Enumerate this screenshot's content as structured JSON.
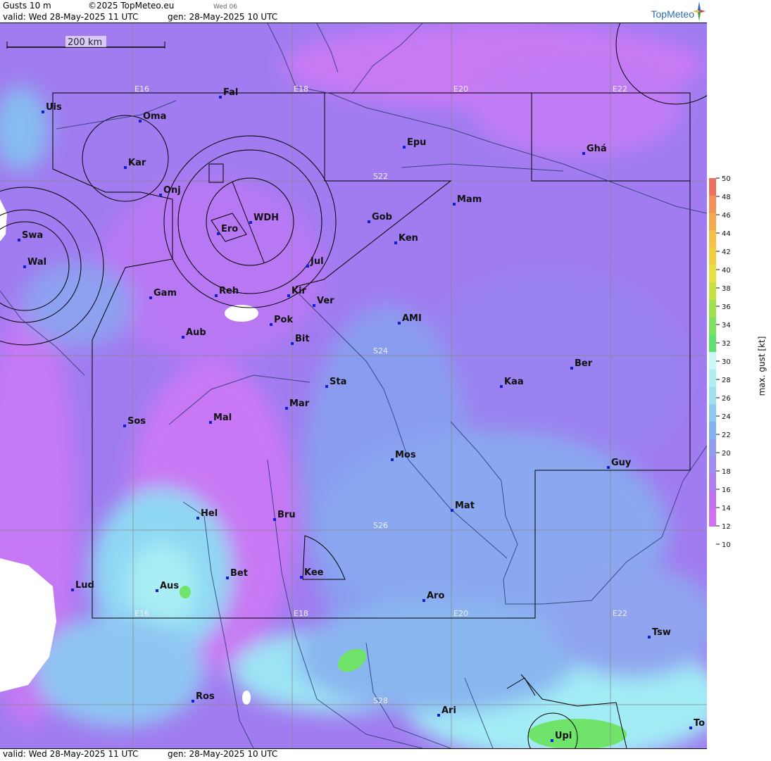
{
  "header": {
    "product": "Gusts 10 m",
    "copyright": "©2025 TopMeteo.eu",
    "day": "Wed 06",
    "valid": "valid:  Wed  28-May-2025  11 UTC",
    "gen": "gen: 28-May-2025 10 UTC",
    "logo": "TopMeteo"
  },
  "footer": {
    "valid": "valid:  Wed  28-May-2025  11 UTC",
    "gen": "gen: 28-May-2025 10 UTC"
  },
  "scale_bar": {
    "label": "200 km"
  },
  "grid_labels": [
    "E16",
    "E18",
    "E20",
    "E22",
    "S22",
    "S24",
    "S26",
    "S28"
  ],
  "cities": [
    {
      "name": "Uis"
    },
    {
      "name": "Fal"
    },
    {
      "name": "Oma"
    },
    {
      "name": "Kar"
    },
    {
      "name": "Onj"
    },
    {
      "name": "Epu"
    },
    {
      "name": "Ghá"
    },
    {
      "name": "Mam"
    },
    {
      "name": "Gob"
    },
    {
      "name": "Ken"
    },
    {
      "name": "WDH"
    },
    {
      "name": "Ero"
    },
    {
      "name": "Swa"
    },
    {
      "name": "Wal"
    },
    {
      "name": "Jul"
    },
    {
      "name": "Gam"
    },
    {
      "name": "Reh"
    },
    {
      "name": "Kir"
    },
    {
      "name": "Ver"
    },
    {
      "name": "Pok"
    },
    {
      "name": "AMI"
    },
    {
      "name": "Aub"
    },
    {
      "name": "Bit"
    },
    {
      "name": "Ber"
    },
    {
      "name": "Sta"
    },
    {
      "name": "Kaa"
    },
    {
      "name": "Mar"
    },
    {
      "name": "Sos"
    },
    {
      "name": "Mal"
    },
    {
      "name": "Mos"
    },
    {
      "name": "Guy"
    },
    {
      "name": "Mat"
    },
    {
      "name": "Hel"
    },
    {
      "name": "Bru"
    },
    {
      "name": "Bet"
    },
    {
      "name": "Kee"
    },
    {
      "name": "Lud"
    },
    {
      "name": "Aus"
    },
    {
      "name": "Aro"
    },
    {
      "name": "Tsw"
    },
    {
      "name": "Ros"
    },
    {
      "name": "Ari"
    },
    {
      "name": "To"
    },
    {
      "name": "Upi"
    }
  ],
  "legend": {
    "title": "max. gust [kt]",
    "ticks": [
      "50",
      "48",
      "46",
      "44",
      "42",
      "40",
      "38",
      "36",
      "34",
      "32",
      "30",
      "28",
      "26",
      "24",
      "22",
      "20",
      "18",
      "16",
      "14",
      "12",
      "10"
    ],
    "colors": [
      "#f07060",
      "#f4905a",
      "#f4a850",
      "#f4c048",
      "#f0d040",
      "#e8e040",
      "#c8e040",
      "#a0e050",
      "#80e060",
      "#60e070",
      "#c8f8f8",
      "#b0eef4",
      "#9edff0",
      "#8ccaf0",
      "#7fb4f0",
      "#8f9cf0",
      "#a08cf0",
      "#b07cf0",
      "#c070f0",
      "#d070f0"
    ],
    "colors_meaning": "top to bottom, 50kt to 12kt"
  }
}
